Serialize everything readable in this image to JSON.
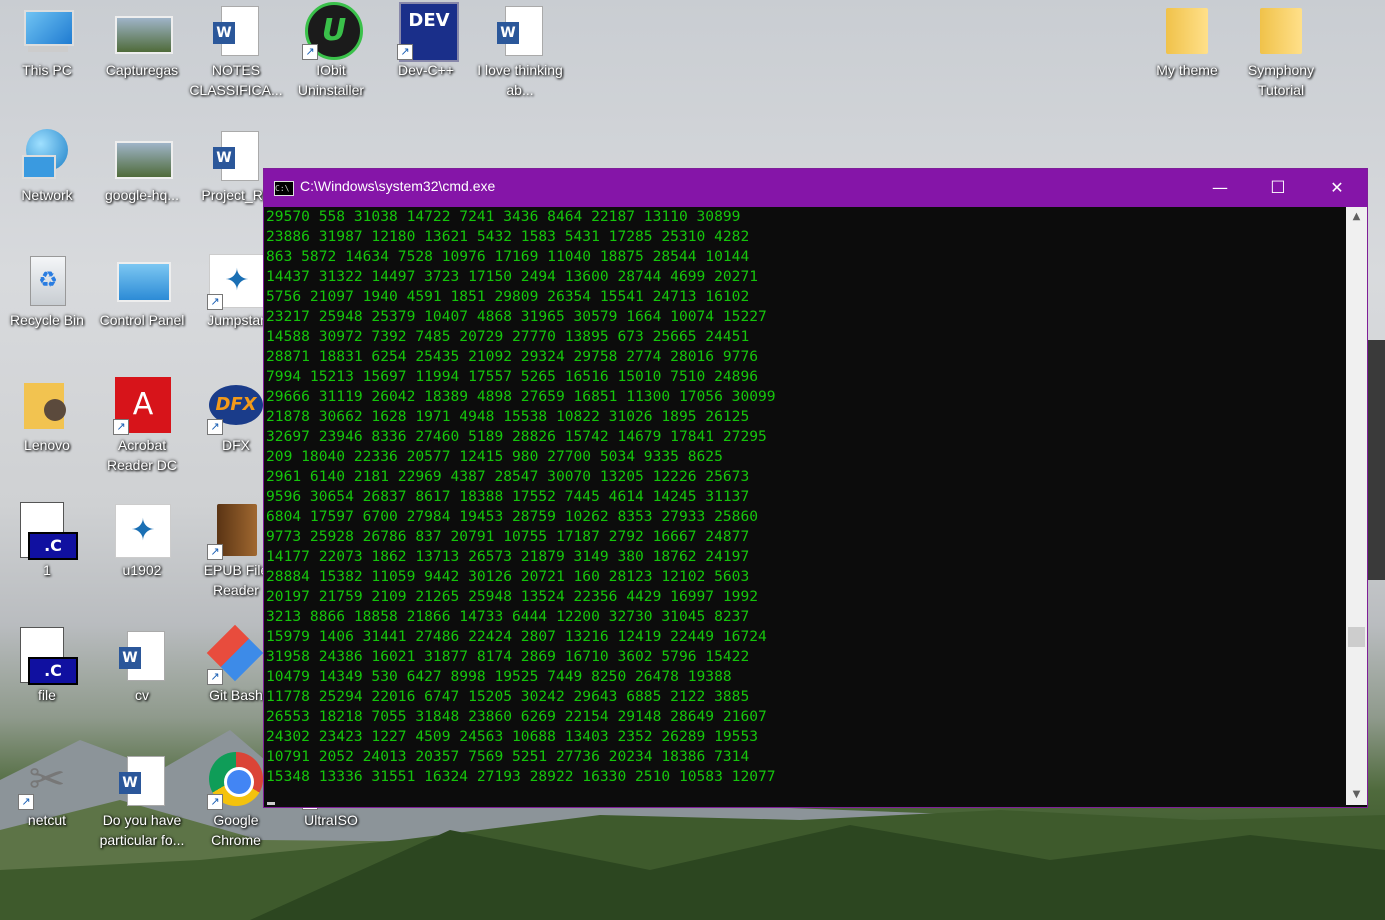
{
  "desktop": {
    "icons": [
      {
        "label": "This PC",
        "icon": "computer-icon"
      },
      {
        "label": "Capturegas",
        "icon": "image-icon"
      },
      {
        "label": "NOTES CLASSIFICA...",
        "icon": "word-doc-icon"
      },
      {
        "label": "IObit Uninstaller",
        "icon": "iobit-icon"
      },
      {
        "label": "Dev-C++",
        "icon": "devcpp-icon"
      },
      {
        "label": "I love thinking ab...",
        "icon": "word-doc-icon"
      },
      {
        "label": "My theme",
        "icon": "folder-icon"
      },
      {
        "label": "Symphony Tutorial",
        "icon": "folder-icon"
      },
      {
        "label": "Network",
        "icon": "network-icon"
      },
      {
        "label": "google-hq...",
        "icon": "image-icon"
      },
      {
        "label": "Project_Re",
        "icon": "word-doc-icon"
      },
      {
        "label": "Recycle Bin",
        "icon": "recycle-bin-icon"
      },
      {
        "label": "Control Panel",
        "icon": "control-panel-icon"
      },
      {
        "label": "Jumpstar",
        "icon": "app-icon"
      },
      {
        "label": "Lenovo",
        "icon": "user-folder-icon"
      },
      {
        "label": "Acrobat Reader DC",
        "icon": "acrobat-icon"
      },
      {
        "label": "DFX",
        "icon": "dfx-icon"
      },
      {
        "label": "1",
        "icon": "c-file-icon"
      },
      {
        "label": "u1902",
        "icon": "app-icon"
      },
      {
        "label": "EPUB File Reader",
        "icon": "book-icon"
      },
      {
        "label": "file",
        "icon": "c-file-icon"
      },
      {
        "label": "cv",
        "icon": "word-doc-icon"
      },
      {
        "label": "Git Bash",
        "icon": "git-icon"
      },
      {
        "label": "netcut",
        "icon": "scissors-icon"
      },
      {
        "label": "Do you have particular fo...",
        "icon": "word-doc-icon"
      },
      {
        "label": "Google Chrome",
        "icon": "chrome-icon"
      },
      {
        "label": "UltraISO",
        "icon": "disc-icon"
      }
    ]
  },
  "window": {
    "title": "C:\\Windows\\system32\\cmd.exe",
    "minimize": "—",
    "maximize": "☐",
    "close": "✕",
    "icon_text": "C:\\",
    "scroll_up": "▲",
    "scroll_down": "▼"
  },
  "console": {
    "lines": [
      "29570 558 31038 14722 7241 3436 8464 22187 13110 30899",
      "23886 31987 12180 13621 5432 1583 5431 17285 25310 4282",
      "863 5872 14634 7528 10976 17169 11040 18875 28544 10144",
      "14437 31322 14497 3723 17150 2494 13600 28744 4699 20271",
      "5756 21097 1940 4591 1851 29809 26354 15541 24713 16102",
      "23217 25948 25379 10407 4868 31965 30579 1664 10074 15227",
      "14588 30972 7392 7485 20729 27770 13895 673 25665 24451",
      "28871 18831 6254 25435 21092 29324 29758 2774 28016 9776",
      "7994 15213 15697 11994 17557 5265 16516 15010 7510 24896",
      "29666 31119 26042 18389 4898 27659 16851 11300 17056 30099",
      "21878 30662 1628 1971 4948 15538 10822 31026 1895 26125",
      "32697 23946 8336 27460 5189 28826 15742 14679 17841 27295",
      "209 18040 22336 20577 12415 980 27700 5034 9335 8625",
      "2961 6140 2181 22969 4387 28547 30070 13205 12226 25673",
      "9596 30654 26837 8617 18388 17552 7445 4614 14245 31137",
      "6804 17597 6700 27984 19453 28759 10262 8353 27933 25860",
      "9773 25928 26786 837 20791 10755 17187 2792 16667 24877",
      "14177 22073 1862 13713 26573 21879 3149 380 18762 24197",
      "28884 15382 11059 9442 30126 20721 160 28123 12102 5603",
      "20197 21759 2109 21265 25948 13524 22356 4429 16997 1992",
      "3213 8866 18858 21866 14733 6444 12200 32730 31045 8237",
      "15979 1406 31441 27486 22424 2807 13216 12419 22449 16724",
      "31958 24386 16021 31877 8174 2869 16710 3602 5796 15422",
      "10479 14349 530 6427 8998 19525 7449 8250 26478 19388",
      "11778 25294 22016 6747 15205 30242 29643 6885 2122 3885",
      "26553 18218 7055 31848 23860 6269 22154 29148 28649 21607",
      "24302 23423 1227 4509 24563 10688 13403 2352 26289 19553",
      "10791 2052 24013 20357 7569 5251 27736 20234 18386 7314",
      "15348 13336 31551 16324 27193 28922 16330 2510 10583 12077"
    ]
  }
}
